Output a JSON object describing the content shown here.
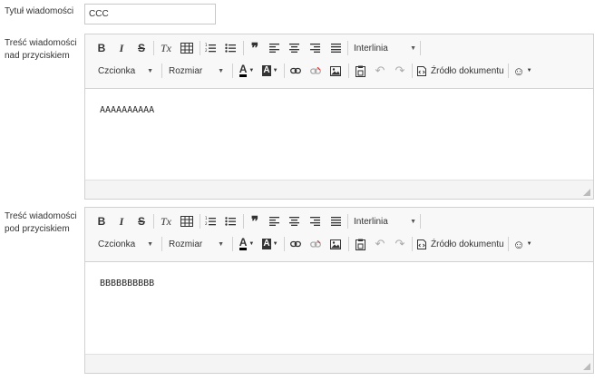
{
  "form": {
    "title_label": "Tytuł wiadomości",
    "title_value": "CCC",
    "editors": [
      {
        "label_line1": "Treść wiadomości",
        "label_line2": "nad przyciskiem",
        "content": "AAAAAAAAAA"
      },
      {
        "label_line1": "Treść wiadomości",
        "label_line2": "pod przyciskiem",
        "content": "BBBBBBBBBB"
      }
    ]
  },
  "toolbar": {
    "bold": "B",
    "italic": "I",
    "strike": "S",
    "clear_format": "Tx",
    "quote": "❞",
    "line_height_label": "Interlinia",
    "font_label": "Czcionka",
    "size_label": "Rozmiar",
    "text_color": "A",
    "bg_color": "A",
    "source_label": "Źródło dokumentu",
    "emoji": "☺"
  }
}
